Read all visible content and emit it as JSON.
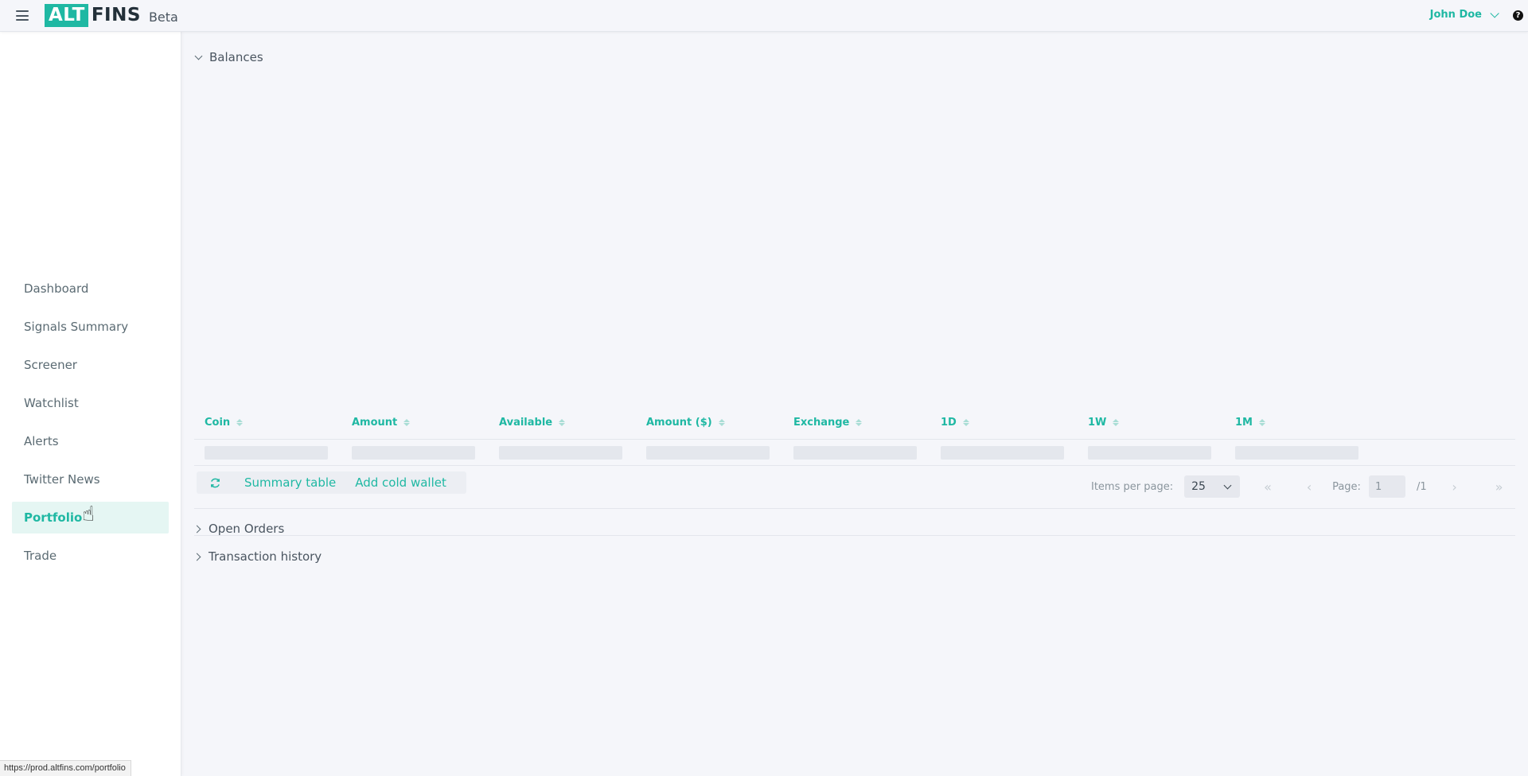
{
  "header": {
    "logo_alt": "ALT",
    "logo_fins": "FINS",
    "beta": "Beta",
    "user_name": "John Doe",
    "help": "?",
    "accent_color": "#1fb8a3"
  },
  "sidebar": {
    "items": [
      {
        "label": "Dashboard"
      },
      {
        "label": "Signals Summary"
      },
      {
        "label": "Screener"
      },
      {
        "label": "Watchlist"
      },
      {
        "label": "Alerts"
      },
      {
        "label": "Twitter News"
      },
      {
        "label": "Portfolio",
        "active": true
      },
      {
        "label": "Trade"
      }
    ]
  },
  "main": {
    "balances_title": "Balances",
    "columns": [
      "Coin",
      "Amount",
      "Available",
      "Amount ($)",
      "Exchange",
      "1D",
      "1W",
      "1M"
    ],
    "toolbar": {
      "refresh_icon": "refresh-icon",
      "summary_table": "Summary table",
      "add_cold_wallet": "Add cold wallet"
    },
    "pagination": {
      "items_per_page_label": "Items per page:",
      "items_per_page_value": "25",
      "page_label": "Page:",
      "page_value": "1",
      "total_pages": "/1",
      "first": "«",
      "prev": "‹",
      "next": "›",
      "last": "»"
    },
    "open_orders_title": "Open Orders",
    "transaction_history_title": "Transaction history"
  },
  "statusbar": {
    "url": "https://prod.altfins.com/portfolio"
  }
}
